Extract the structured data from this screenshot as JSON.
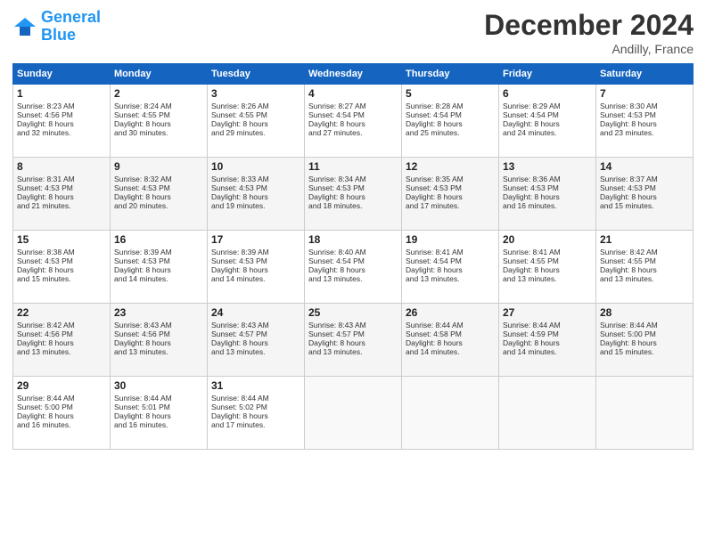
{
  "header": {
    "logo_line1": "General",
    "logo_line2": "Blue",
    "month": "December 2024",
    "location": "Andilly, France"
  },
  "days_header": [
    "Sunday",
    "Monday",
    "Tuesday",
    "Wednesday",
    "Thursday",
    "Friday",
    "Saturday"
  ],
  "weeks": [
    [
      {
        "day": "1",
        "lines": [
          "Sunrise: 8:23 AM",
          "Sunset: 4:56 PM",
          "Daylight: 8 hours",
          "and 32 minutes."
        ]
      },
      {
        "day": "2",
        "lines": [
          "Sunrise: 8:24 AM",
          "Sunset: 4:55 PM",
          "Daylight: 8 hours",
          "and 30 minutes."
        ]
      },
      {
        "day": "3",
        "lines": [
          "Sunrise: 8:26 AM",
          "Sunset: 4:55 PM",
          "Daylight: 8 hours",
          "and 29 minutes."
        ]
      },
      {
        "day": "4",
        "lines": [
          "Sunrise: 8:27 AM",
          "Sunset: 4:54 PM",
          "Daylight: 8 hours",
          "and 27 minutes."
        ]
      },
      {
        "day": "5",
        "lines": [
          "Sunrise: 8:28 AM",
          "Sunset: 4:54 PM",
          "Daylight: 8 hours",
          "and 25 minutes."
        ]
      },
      {
        "day": "6",
        "lines": [
          "Sunrise: 8:29 AM",
          "Sunset: 4:54 PM",
          "Daylight: 8 hours",
          "and 24 minutes."
        ]
      },
      {
        "day": "7",
        "lines": [
          "Sunrise: 8:30 AM",
          "Sunset: 4:53 PM",
          "Daylight: 8 hours",
          "and 23 minutes."
        ]
      }
    ],
    [
      {
        "day": "8",
        "lines": [
          "Sunrise: 8:31 AM",
          "Sunset: 4:53 PM",
          "Daylight: 8 hours",
          "and 21 minutes."
        ]
      },
      {
        "day": "9",
        "lines": [
          "Sunrise: 8:32 AM",
          "Sunset: 4:53 PM",
          "Daylight: 8 hours",
          "and 20 minutes."
        ]
      },
      {
        "day": "10",
        "lines": [
          "Sunrise: 8:33 AM",
          "Sunset: 4:53 PM",
          "Daylight: 8 hours",
          "and 19 minutes."
        ]
      },
      {
        "day": "11",
        "lines": [
          "Sunrise: 8:34 AM",
          "Sunset: 4:53 PM",
          "Daylight: 8 hours",
          "and 18 minutes."
        ]
      },
      {
        "day": "12",
        "lines": [
          "Sunrise: 8:35 AM",
          "Sunset: 4:53 PM",
          "Daylight: 8 hours",
          "and 17 minutes."
        ]
      },
      {
        "day": "13",
        "lines": [
          "Sunrise: 8:36 AM",
          "Sunset: 4:53 PM",
          "Daylight: 8 hours",
          "and 16 minutes."
        ]
      },
      {
        "day": "14",
        "lines": [
          "Sunrise: 8:37 AM",
          "Sunset: 4:53 PM",
          "Daylight: 8 hours",
          "and 15 minutes."
        ]
      }
    ],
    [
      {
        "day": "15",
        "lines": [
          "Sunrise: 8:38 AM",
          "Sunset: 4:53 PM",
          "Daylight: 8 hours",
          "and 15 minutes."
        ]
      },
      {
        "day": "16",
        "lines": [
          "Sunrise: 8:39 AM",
          "Sunset: 4:53 PM",
          "Daylight: 8 hours",
          "and 14 minutes."
        ]
      },
      {
        "day": "17",
        "lines": [
          "Sunrise: 8:39 AM",
          "Sunset: 4:53 PM",
          "Daylight: 8 hours",
          "and 14 minutes."
        ]
      },
      {
        "day": "18",
        "lines": [
          "Sunrise: 8:40 AM",
          "Sunset: 4:54 PM",
          "Daylight: 8 hours",
          "and 13 minutes."
        ]
      },
      {
        "day": "19",
        "lines": [
          "Sunrise: 8:41 AM",
          "Sunset: 4:54 PM",
          "Daylight: 8 hours",
          "and 13 minutes."
        ]
      },
      {
        "day": "20",
        "lines": [
          "Sunrise: 8:41 AM",
          "Sunset: 4:55 PM",
          "Daylight: 8 hours",
          "and 13 minutes."
        ]
      },
      {
        "day": "21",
        "lines": [
          "Sunrise: 8:42 AM",
          "Sunset: 4:55 PM",
          "Daylight: 8 hours",
          "and 13 minutes."
        ]
      }
    ],
    [
      {
        "day": "22",
        "lines": [
          "Sunrise: 8:42 AM",
          "Sunset: 4:56 PM",
          "Daylight: 8 hours",
          "and 13 minutes."
        ]
      },
      {
        "day": "23",
        "lines": [
          "Sunrise: 8:43 AM",
          "Sunset: 4:56 PM",
          "Daylight: 8 hours",
          "and 13 minutes."
        ]
      },
      {
        "day": "24",
        "lines": [
          "Sunrise: 8:43 AM",
          "Sunset: 4:57 PM",
          "Daylight: 8 hours",
          "and 13 minutes."
        ]
      },
      {
        "day": "25",
        "lines": [
          "Sunrise: 8:43 AM",
          "Sunset: 4:57 PM",
          "Daylight: 8 hours",
          "and 13 minutes."
        ]
      },
      {
        "day": "26",
        "lines": [
          "Sunrise: 8:44 AM",
          "Sunset: 4:58 PM",
          "Daylight: 8 hours",
          "and 14 minutes."
        ]
      },
      {
        "day": "27",
        "lines": [
          "Sunrise: 8:44 AM",
          "Sunset: 4:59 PM",
          "Daylight: 8 hours",
          "and 14 minutes."
        ]
      },
      {
        "day": "28",
        "lines": [
          "Sunrise: 8:44 AM",
          "Sunset: 5:00 PM",
          "Daylight: 8 hours",
          "and 15 minutes."
        ]
      }
    ],
    [
      {
        "day": "29",
        "lines": [
          "Sunrise: 8:44 AM",
          "Sunset: 5:00 PM",
          "Daylight: 8 hours",
          "and 16 minutes."
        ]
      },
      {
        "day": "30",
        "lines": [
          "Sunrise: 8:44 AM",
          "Sunset: 5:01 PM",
          "Daylight: 8 hours",
          "and 16 minutes."
        ]
      },
      {
        "day": "31",
        "lines": [
          "Sunrise: 8:44 AM",
          "Sunset: 5:02 PM",
          "Daylight: 8 hours",
          "and 17 minutes."
        ]
      },
      {
        "day": "",
        "lines": []
      },
      {
        "day": "",
        "lines": []
      },
      {
        "day": "",
        "lines": []
      },
      {
        "day": "",
        "lines": []
      }
    ]
  ]
}
